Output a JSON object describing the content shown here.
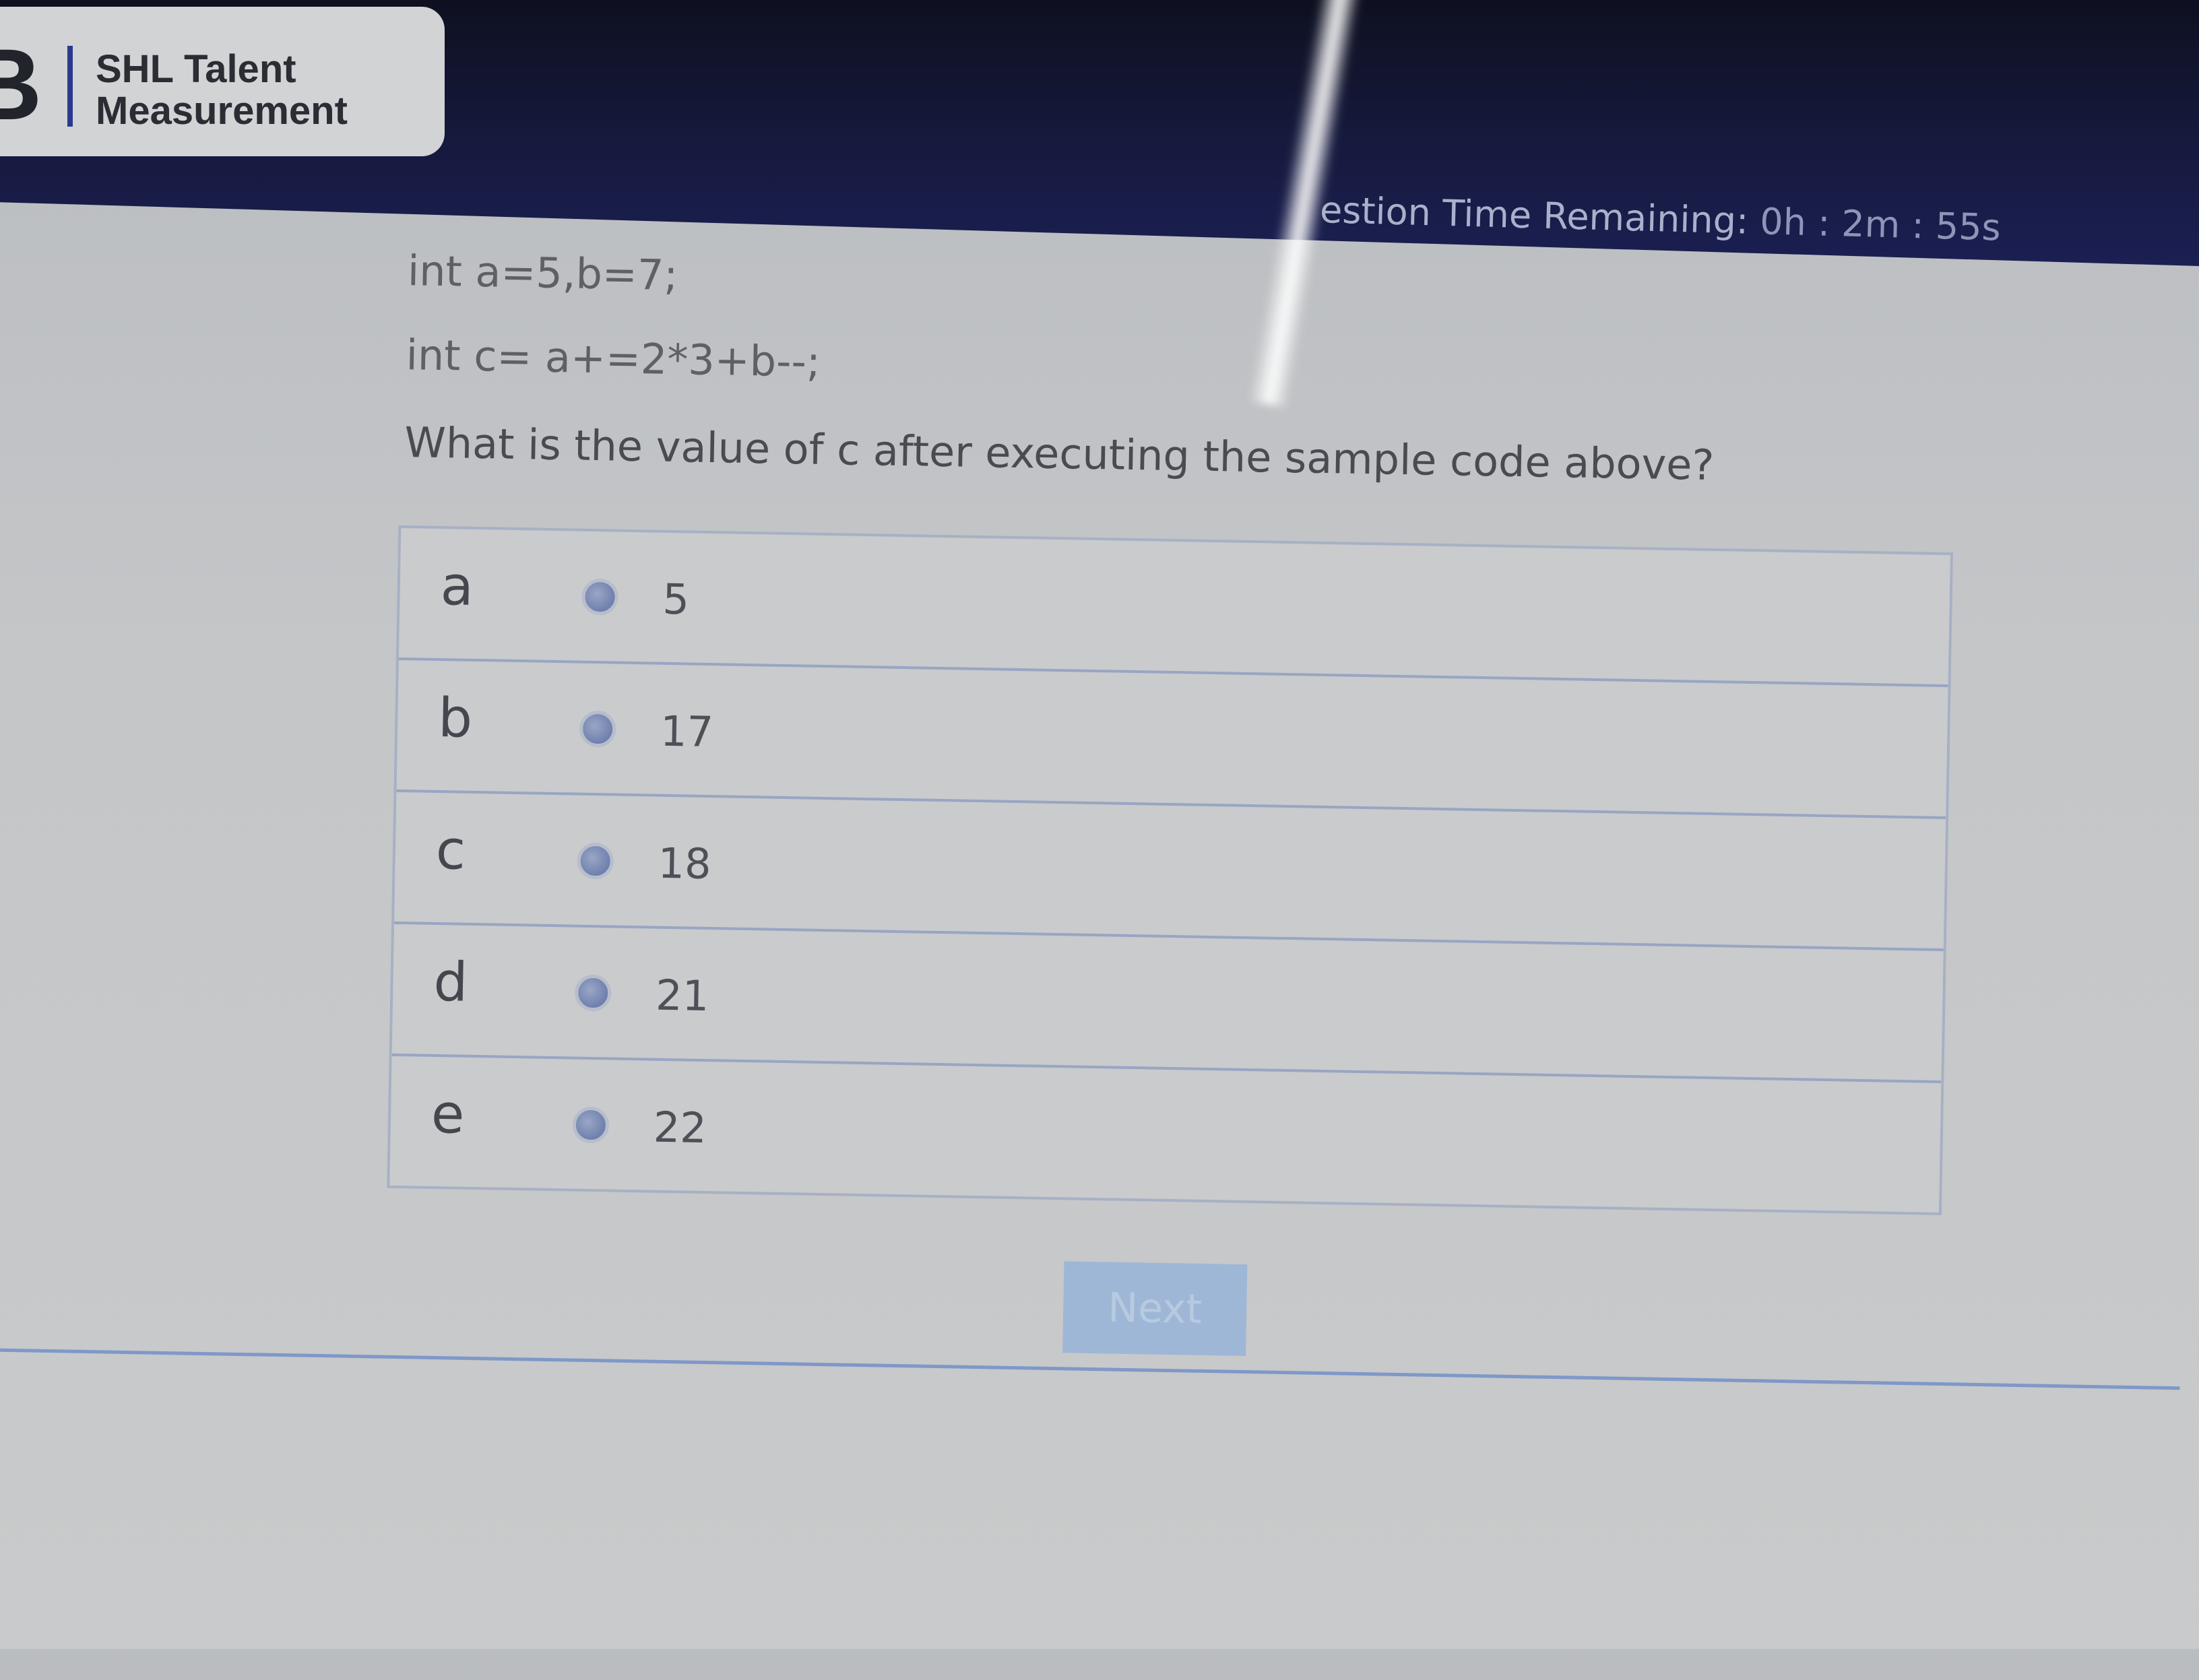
{
  "header": {
    "logo_mark": "B",
    "logo_line1": "SHL Talent",
    "logo_line2": "Measurement",
    "timer_label": "estion Time Remaining:",
    "timer_value": "0h : 2m : 55s"
  },
  "question": {
    "code_line1": "int a=5,b=7;",
    "code_line2": "int c= a+=2*3+b--;",
    "prompt": "What is the value of c after executing the sample code above?"
  },
  "options": [
    {
      "letter": "a",
      "value": "5"
    },
    {
      "letter": "b",
      "value": "17"
    },
    {
      "letter": "c",
      "value": "18"
    },
    {
      "letter": "d",
      "value": "21"
    },
    {
      "letter": "e",
      "value": "22"
    }
  ],
  "actions": {
    "next_label": "Next"
  },
  "colors": {
    "header_bg": "#161a3e",
    "radio": "#6f80ad",
    "next_button": "#9fb7d6"
  }
}
